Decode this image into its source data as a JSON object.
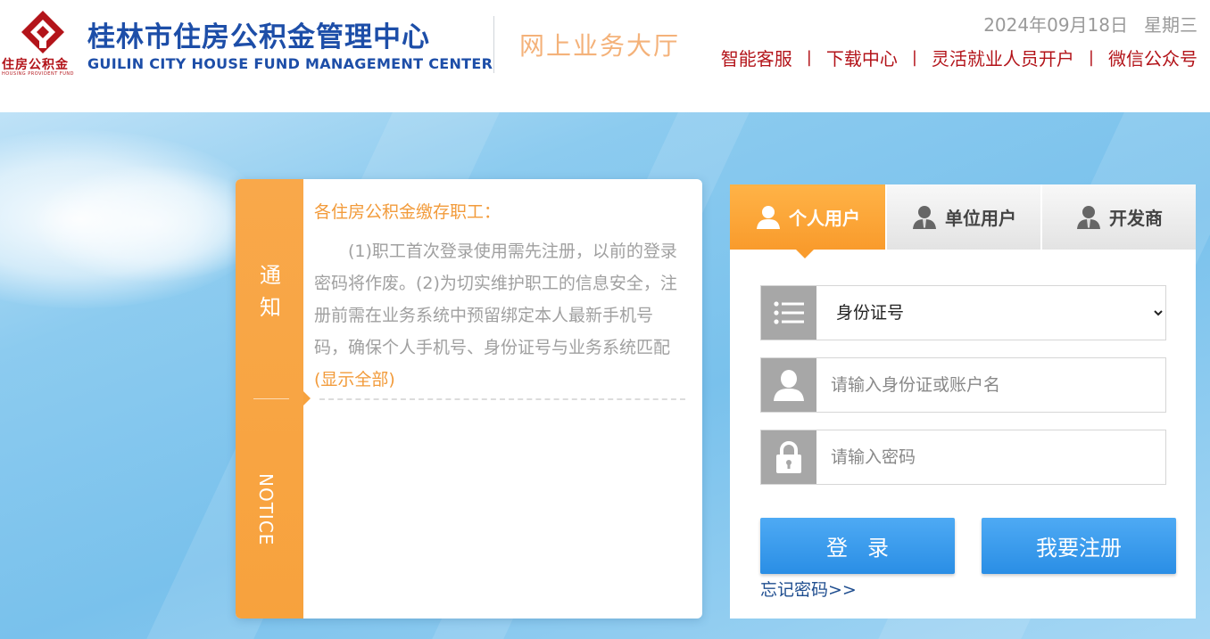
{
  "header": {
    "logo_icon": "housing-fund-logo-icon",
    "logo_small_cn": "住房公积金",
    "logo_tiny_en": "HOUSING PROVIDENT FUND",
    "org_name_cn": "桂林市住房公积金管理中心",
    "org_name_en": "GUILIN CITY HOUSE FUND  MANAGEMENT CENTER",
    "subtitle": "网上业务大厅",
    "date": "2024年09月18日",
    "weekday": "星期三",
    "nav": [
      {
        "label": "智能客服"
      },
      {
        "label": "下载中心"
      },
      {
        "label": "灵活就业人员开户"
      },
      {
        "label": "微信公众号"
      }
    ],
    "nav_separator": "|"
  },
  "notice": {
    "strip_cn": "通知",
    "strip_en": "NOTICE",
    "title": "各住房公积金缴存职工：",
    "body": "(1)职工首次登录使用需先注册，以前的登录密码将作废。(2)为切实维护职工的信息安全，注册前需在业务系统中预留绑定本人最新手机号码，确保个人手机号、身份证号与业务系统匹配",
    "show_all": "(显示全部)"
  },
  "login": {
    "tabs": [
      {
        "label": "个人用户",
        "icon": "user-icon",
        "active": true
      },
      {
        "label": "单位用户",
        "icon": "user-icon",
        "active": false
      },
      {
        "label": "开发商",
        "icon": "user-icon",
        "active": false
      }
    ],
    "id_type": {
      "icon": "list-icon",
      "selected": "身份证号"
    },
    "account": {
      "icon": "user-icon",
      "placeholder": "请输入身份证或账户名",
      "value": ""
    },
    "password": {
      "icon": "lock-icon",
      "placeholder": "请输入密码",
      "value": ""
    },
    "login_button": "登录",
    "register_button": "我要注册",
    "forgot_link": "忘记密码>>"
  },
  "colors": {
    "brand_red": "#b3141a",
    "brand_blue": "#1d4ea8",
    "accent_orange": "#f99b2c",
    "button_blue": "#2a8ee5",
    "sky_blue": "#79c1ec"
  }
}
